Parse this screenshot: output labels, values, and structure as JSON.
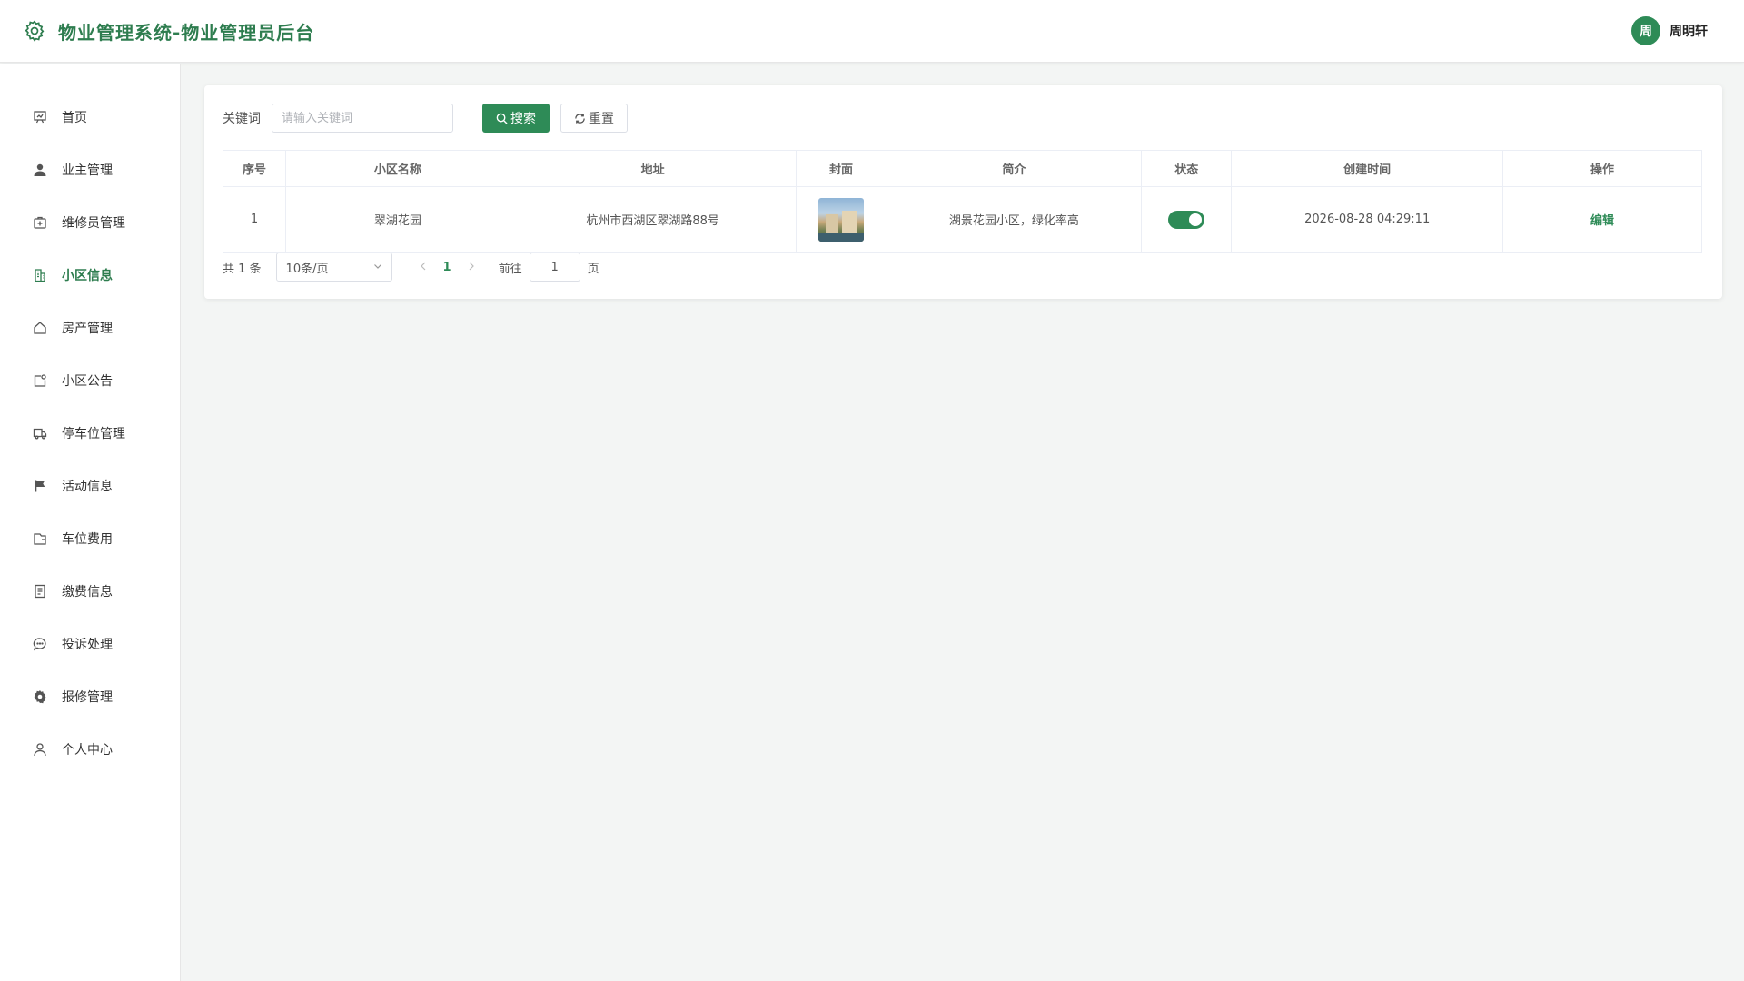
{
  "header": {
    "title": "物业管理系统-物业管理员后台",
    "user_avatar_text": "周",
    "user_name": "周明轩"
  },
  "sidebar": {
    "items": [
      {
        "label": "首页",
        "icon": "presentation-icon"
      },
      {
        "label": "业主管理",
        "icon": "user-filled-icon"
      },
      {
        "label": "维修员管理",
        "icon": "first-aid-kit-icon"
      },
      {
        "label": "小区信息",
        "icon": "office-building-icon",
        "active": true
      },
      {
        "label": "房产管理",
        "icon": "house-icon"
      },
      {
        "label": "小区公告",
        "icon": "notification-icon"
      },
      {
        "label": "停车位管理",
        "icon": "van-icon"
      },
      {
        "label": "活动信息",
        "icon": "flag-icon"
      },
      {
        "label": "车位费用",
        "icon": "wallet-icon"
      },
      {
        "label": "缴费信息",
        "icon": "document-icon"
      },
      {
        "label": "投诉处理",
        "icon": "chat-dot-icon"
      },
      {
        "label": "报修管理",
        "icon": "gear-filled-icon"
      },
      {
        "label": "个人中心",
        "icon": "user-icon"
      }
    ]
  },
  "search": {
    "label": "关键词",
    "placeholder": "请输入关键词",
    "search_button": "搜索",
    "reset_button": "重置"
  },
  "table": {
    "columns": [
      "序号",
      "小区名称",
      "地址",
      "封面",
      "简介",
      "状态",
      "创建时间",
      "操作"
    ],
    "rows": [
      {
        "index": "1",
        "name": "翠湖花园",
        "address": "杭州市西湖区翠湖路88号",
        "cover": "community-photo",
        "intro": "湖景花园小区，绿化率高",
        "status_on": true,
        "created_at": "2026-08-28 04:29:11",
        "action": "编辑"
      }
    ]
  },
  "pagination": {
    "total": "共 1 条",
    "page_size": "10条/页",
    "current_page": "1",
    "goto_label": "前往",
    "goto_value": "1",
    "page_suffix": "页"
  },
  "colors": {
    "accent": "#2e8b57",
    "title": "#2e7d4f"
  }
}
